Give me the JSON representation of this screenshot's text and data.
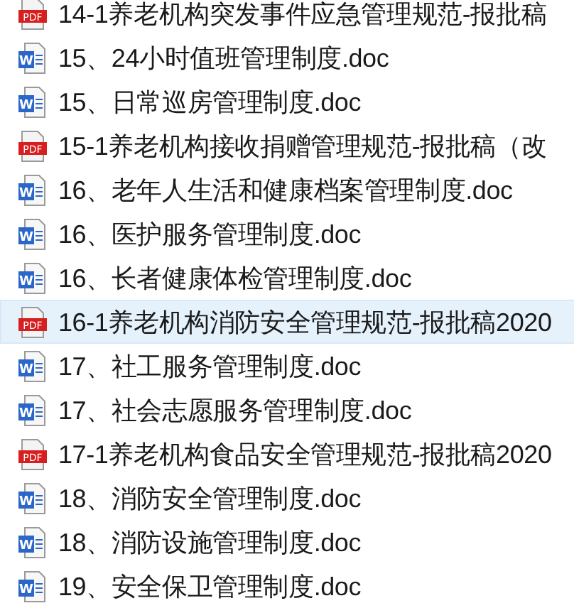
{
  "files": [
    {
      "kind": "pdf",
      "badge": "PDF",
      "name": "14-1养老机构突发事件应急管理规范-报批稿",
      "selected": false
    },
    {
      "kind": "doc",
      "badge": "W",
      "name": "15、24小时值班管理制度.doc",
      "selected": false
    },
    {
      "kind": "doc",
      "badge": "W",
      "name": "15、日常巡房管理制度.doc",
      "selected": false
    },
    {
      "kind": "pdf",
      "badge": "PDF",
      "name": "15-1养老机构接收捐赠管理规范-报批稿（改",
      "selected": false
    },
    {
      "kind": "doc",
      "badge": "W",
      "name": "16、老年人生活和健康档案管理制度.doc",
      "selected": false
    },
    {
      "kind": "doc",
      "badge": "W",
      "name": "16、医护服务管理制度.doc",
      "selected": false
    },
    {
      "kind": "doc",
      "badge": "W",
      "name": "16、长者健康体检管理制度.doc",
      "selected": false
    },
    {
      "kind": "pdf",
      "badge": "PDF",
      "name": "16-1养老机构消防安全管理规范-报批稿2020",
      "selected": true
    },
    {
      "kind": "doc",
      "badge": "W",
      "name": "17、社工服务管理制度.doc",
      "selected": false
    },
    {
      "kind": "doc",
      "badge": "W",
      "name": "17、社会志愿服务管理制度.doc",
      "selected": false
    },
    {
      "kind": "pdf",
      "badge": "PDF",
      "name": "17-1养老机构食品安全管理规范-报批稿2020",
      "selected": false
    },
    {
      "kind": "doc",
      "badge": "W",
      "name": "18、消防安全管理制度.doc",
      "selected": false
    },
    {
      "kind": "doc",
      "badge": "W",
      "name": "18、消防设施管理制度.doc",
      "selected": false
    },
    {
      "kind": "doc",
      "badge": "W",
      "name": "19、安全保卫管理制度.doc",
      "selected": false
    }
  ]
}
